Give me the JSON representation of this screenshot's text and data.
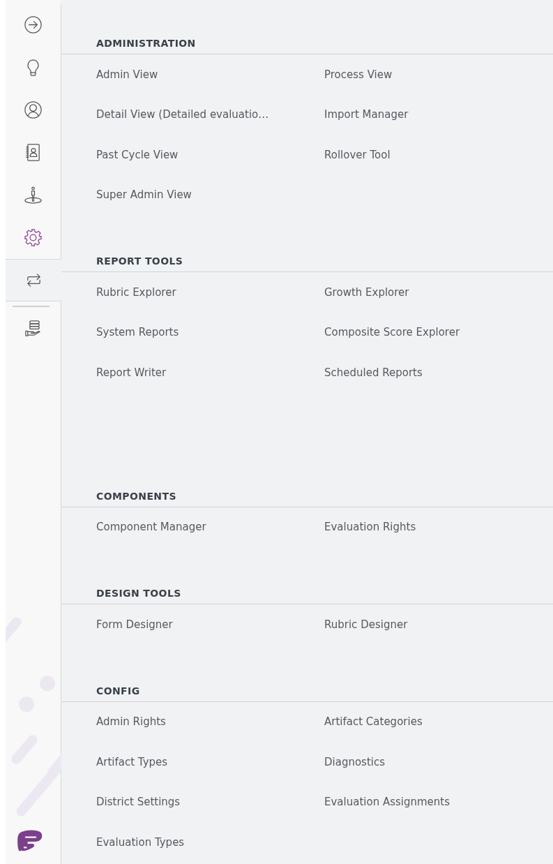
{
  "sidebar": {
    "items": [
      {
        "kind": "arrow-circle",
        "selected": false,
        "highlighted": false
      },
      {
        "kind": "bulb",
        "selected": false,
        "highlighted": false
      },
      {
        "kind": "user-circle",
        "selected": false,
        "highlighted": false
      },
      {
        "kind": "contacts",
        "selected": false,
        "highlighted": false
      },
      {
        "kind": "person-spot",
        "selected": false,
        "highlighted": false
      },
      {
        "kind": "gear",
        "selected": false,
        "highlighted": true
      },
      {
        "kind": "exchange",
        "selected": true,
        "highlighted": false
      },
      {
        "kind": "hand-stack",
        "selected": false,
        "highlighted": false
      }
    ]
  },
  "sections": [
    {
      "title": "ADMINISTRATION",
      "items": [
        "Admin View",
        "Process View",
        "Detail View (Detailed evaluatio…",
        "Import Manager",
        "Past Cycle View",
        "Rollover Tool",
        "Super Admin View"
      ]
    },
    {
      "title": "REPORT TOOLS",
      "items": [
        "Rubric Explorer",
        "Growth Explorer",
        "System Reports",
        "Composite Score Explorer",
        "Report Writer",
        "Scheduled Reports"
      ]
    },
    {
      "title": "COMPONENTS",
      "items": [
        "Component Manager",
        "Evaluation Rights"
      ]
    },
    {
      "title": "DESIGN TOOLS",
      "items": [
        "Form Designer",
        "Rubric Designer"
      ]
    },
    {
      "title": "CONFIG",
      "items": [
        "Admin Rights",
        "Artifact Categories",
        "Artifact Types",
        "Diagnostics",
        "District Settings",
        "Evaluation Assignments",
        "Evaluation Types"
      ]
    }
  ]
}
